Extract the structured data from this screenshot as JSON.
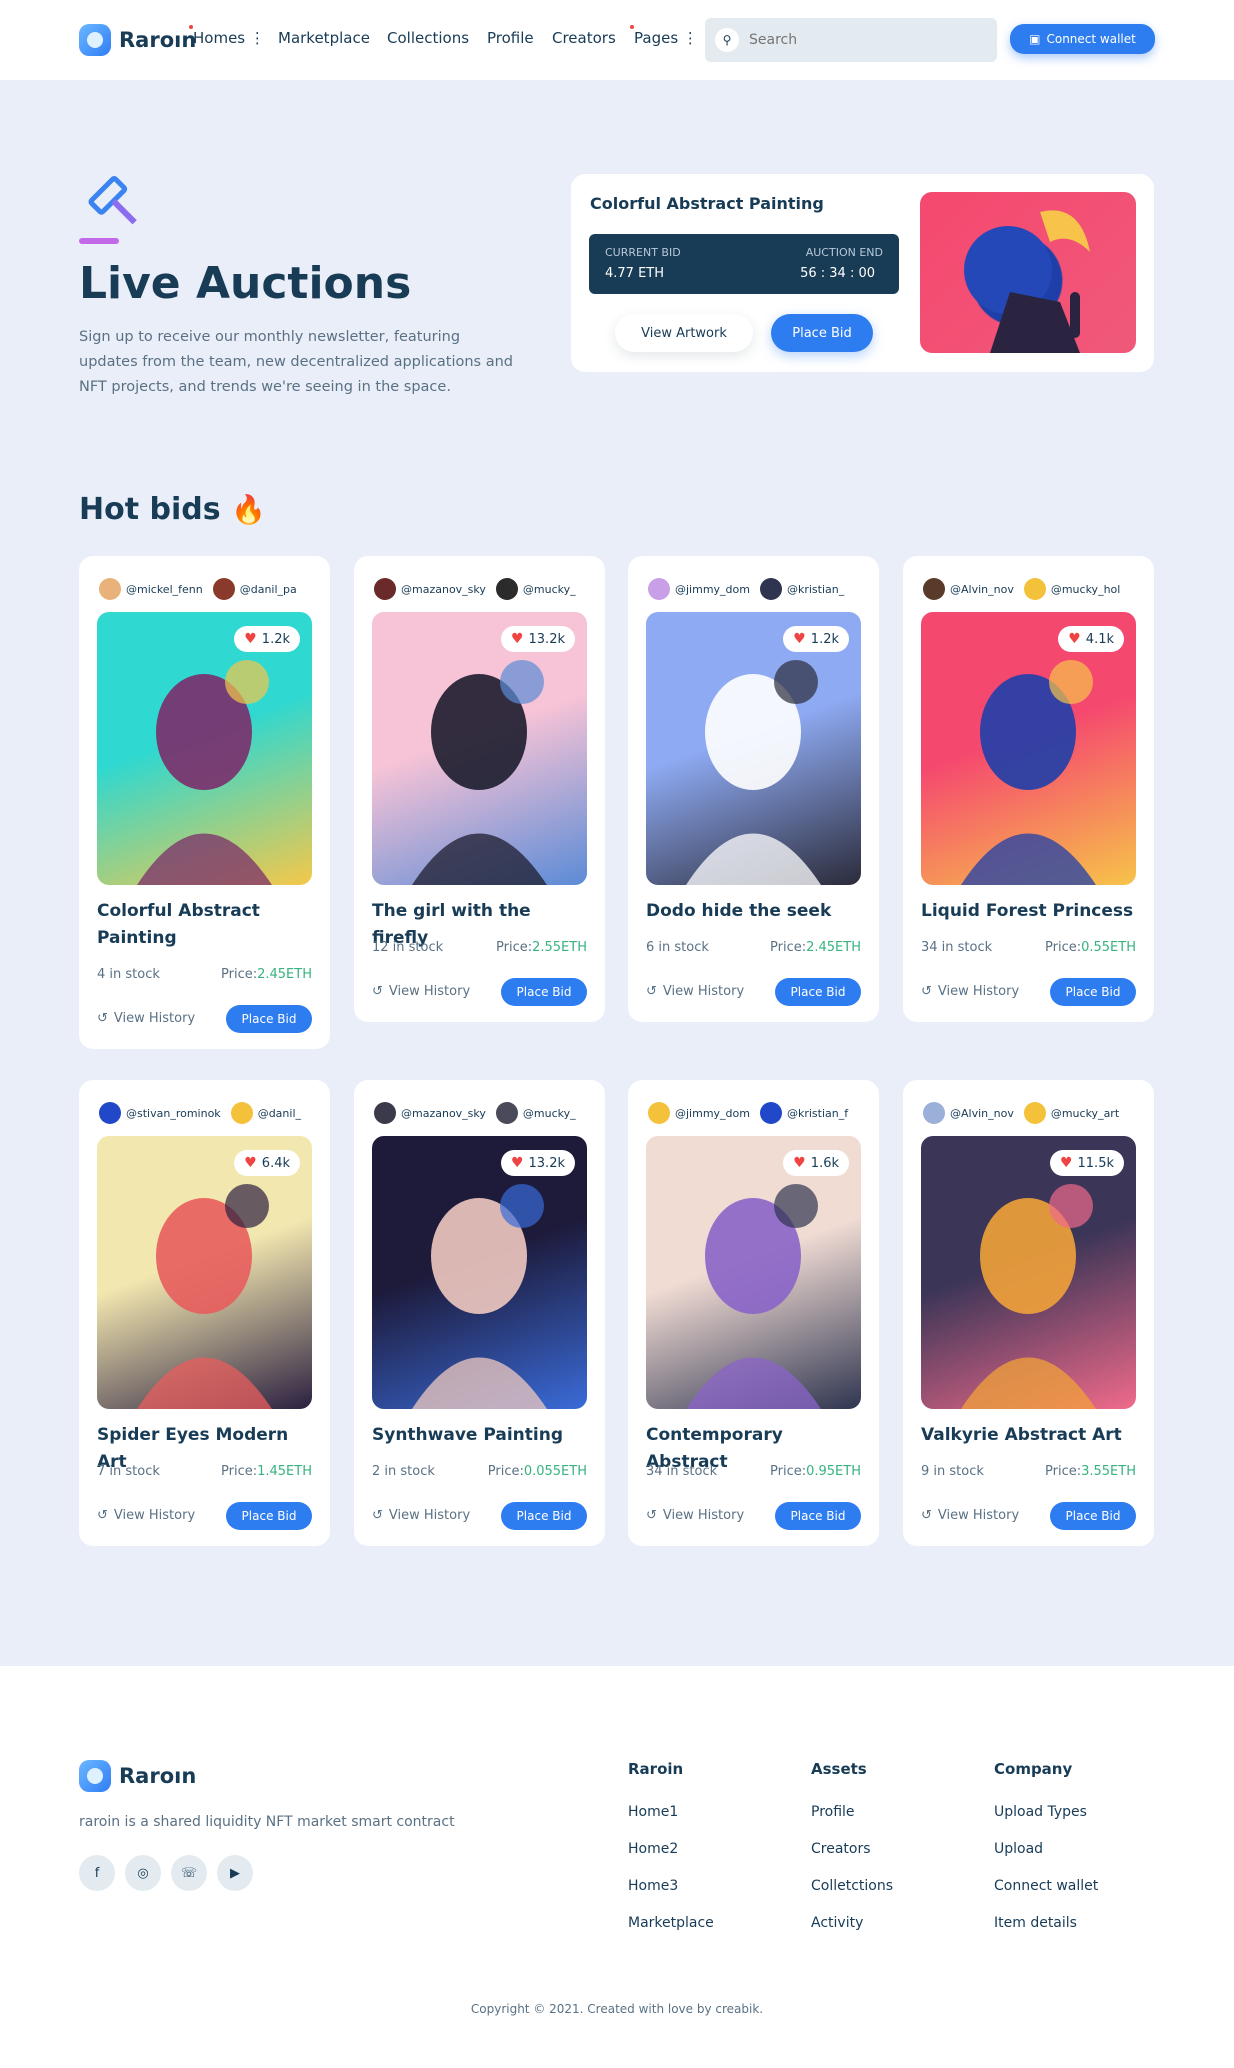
{
  "brand": {
    "name": "Raroın"
  },
  "nav": {
    "items": [
      "Homes",
      "Marketplace",
      "Collections",
      "Profile",
      "Creators",
      "Pages"
    ]
  },
  "search": {
    "placeholder": "Search"
  },
  "header": {
    "connect_label": "Connect wallet"
  },
  "hero": {
    "title": "Live Auctions",
    "text": "Sign up to receive our monthly newsletter, featuring updates from the team, new decentralized applications and NFT projects, and trends we're seeing in the space.",
    "card": {
      "title": "Colorful Abstract Painting",
      "bid_label": "CURRENT BID",
      "bid_value": "4.77 ETH",
      "end_label": "AUCTION END",
      "end_value": "56 : 34 : 00",
      "view_label": "View Artwork",
      "bid_button": "Place Bid"
    }
  },
  "hot": {
    "title": "Hot bids"
  },
  "cards": [
    {
      "u1": "@mickel_fenn",
      "u2": "@danil_pa",
      "likes": "1.2k",
      "title": "Colorful Abstract Painting",
      "stock": "4 in stock",
      "price_label": "Price:",
      "price": "2.45ETH",
      "history": "View History",
      "bid": "Place Bid",
      "c1": "#2fd8d0",
      "c2": "#7b2e6b",
      "c3": "#f4c84a"
    },
    {
      "u1": "@mazanov_sky",
      "u2": "@mucky_",
      "likes": "13.2k",
      "title": "The girl with the firefly",
      "stock": "12 in stock",
      "price_label": "Price:",
      "price": "2.55ETH",
      "history": "View History",
      "bid": "Place Bid",
      "c1": "#f7c3d6",
      "c2": "#1c1c2e",
      "c3": "#5b8bd6"
    },
    {
      "u1": "@jimmy_dom",
      "u2": "@kristian_",
      "likes": "1.2k",
      "title": "Dodo hide the seek",
      "stock": "6 in stock",
      "price_label": "Price:",
      "price": "2.45ETH",
      "history": "View History",
      "bid": "Place Bid",
      "c1": "#8eaaf2",
      "c2": "#ffffff",
      "c3": "#2b2b3a"
    },
    {
      "u1": "@Alvin_nov",
      "u2": "@mucky_hol",
      "likes": "4.1k",
      "title": "Liquid Forest Princess",
      "stock": "34 in stock",
      "price_label": "Price:",
      "price": "0.55ETH",
      "history": "View History",
      "bid": "Place Bid",
      "c1": "#f5486f",
      "c2": "#1f3fa8",
      "c3": "#f7c34a"
    },
    {
      "u1": "@stivan_rominok",
      "u2": "@danil_",
      "likes": "6.4k",
      "title": "Spider Eyes Modern Art",
      "stock": "7 in stock",
      "price_label": "Price:",
      "price": "1.45ETH",
      "history": "View History",
      "bid": "Place Bid",
      "c1": "#f3e7b0",
      "c2": "#e85d5d",
      "c3": "#2b2040"
    },
    {
      "u1": "@mazanov_sky",
      "u2": "@mucky_",
      "likes": "13.2k",
      "title": "Synthwave Painting",
      "stock": "2 in stock",
      "price_label": "Price:",
      "price": "0.055ETH",
      "history": "View History",
      "bid": "Place Bid",
      "c1": "#1d1a3a",
      "c2": "#f0c9c0",
      "c3": "#3a6bd8"
    },
    {
      "u1": "@jimmy_dom",
      "u2": "@kristian_f",
      "likes": "1.6k",
      "title": "Contemporary Abstract",
      "stock": "34 in stock",
      "price_label": "Price:",
      "price": "0.95ETH",
      "history": "View History",
      "bid": "Place Bid",
      "c1": "#f1dcd4",
      "c2": "#8a64c8",
      "c3": "#2f3550"
    },
    {
      "u1": "@Alvin_nov",
      "u2": "@mucky_art",
      "likes": "11.5k",
      "title": "Valkyrie Abstract Art",
      "stock": "9 in stock",
      "price_label": "Price:",
      "price": "3.55ETH",
      "history": "View History",
      "bid": "Place Bid",
      "c1": "#3b3557",
      "c2": "#f2a23a",
      "c3": "#f06a8a"
    }
  ],
  "footer": {
    "brand": "Raroın",
    "tagline": "raroin is a shared liquidity NFT market smart contract",
    "cols": [
      {
        "title": "Raroin",
        "links": [
          "Home1",
          "Home2",
          "Home3",
          "Marketplace"
        ]
      },
      {
        "title": "Assets",
        "links": [
          "Profile",
          "Creators",
          "Colletctions",
          "Activity"
        ]
      },
      {
        "title": "Company",
        "links": [
          "Upload Types",
          "Upload",
          "Connect wallet",
          "Item details"
        ]
      }
    ],
    "social": [
      "facebook-icon",
      "messenger-icon",
      "whatsapp-icon",
      "youtube-icon"
    ],
    "copyright": "Copyright © 2021. Created with love by creabik."
  }
}
